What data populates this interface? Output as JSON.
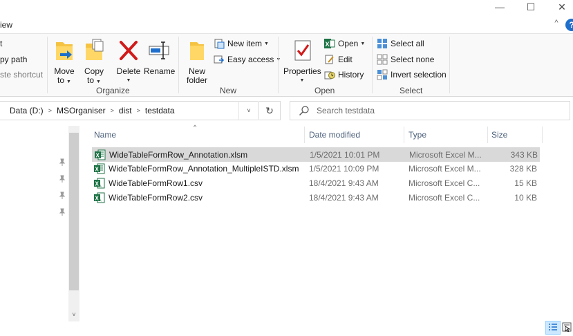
{
  "window": {
    "minimize_glyph": "—",
    "maximize_glyph": "☐",
    "close_glyph": "✕"
  },
  "ribbon_tabs": {
    "view_label_partial": "iew",
    "collapse_glyph": "^",
    "help_glyph": "?"
  },
  "clipboard": {
    "cut_partial": "t",
    "copy_path_partial": "py path",
    "paste_shortcut_partial": "ste shortcut"
  },
  "organize": {
    "label": "Organize",
    "move_to_line1": "Move",
    "move_to_line2": "to",
    "copy_to_line1": "Copy",
    "copy_to_line2": "to",
    "delete_label": "Delete",
    "rename_label": "Rename"
  },
  "new_group": {
    "label": "New",
    "new_folder_line1": "New",
    "new_folder_line2": "folder",
    "new_item_label": "New item",
    "easy_access_label": "Easy access"
  },
  "open_group": {
    "label": "Open",
    "properties_label": "Properties",
    "open_label": "Open",
    "edit_label": "Edit",
    "history_label": "History"
  },
  "select_group": {
    "label": "Select",
    "select_all_label": "Select all",
    "select_none_label": "Select none",
    "invert_selection_label": "Invert selection"
  },
  "address": {
    "segments": [
      "Data (D:)",
      "MSOrganiser",
      "dist",
      "testdata"
    ],
    "dropdown_glyph": "˅",
    "refresh_glyph": "↻"
  },
  "search": {
    "placeholder": "Search testdata"
  },
  "columns": {
    "name": "Name",
    "date_modified": "Date modified",
    "type": "Type",
    "size": "Size",
    "sort_glyph": "^"
  },
  "files": [
    {
      "name": "WideTableFormRow_Annotation.xlsm",
      "date": "1/5/2021 10:01 PM",
      "type": "Microsoft Excel M...",
      "size": "343 KB",
      "selected": true
    },
    {
      "name": "WideTableFormRow_Annotation_MultipleISTD.xlsm",
      "date": "1/5/2021 10:09 PM",
      "type": "Microsoft Excel M...",
      "size": "328 KB",
      "selected": false
    },
    {
      "name": "WideTableFormRow1.csv",
      "date": "18/4/2021 9:43 AM",
      "type": "Microsoft Excel C...",
      "size": "15 KB",
      "selected": false
    },
    {
      "name": "WideTableFormRow2.csv",
      "date": "18/4/2021 9:43 AM",
      "type": "Microsoft Excel C...",
      "size": "10 KB",
      "selected": false
    }
  ],
  "colors": {
    "accent_blue": "#1e6fcc",
    "delete_red": "#d11a1a",
    "folder_yellow": "#f5c342",
    "excel_green": "#1d7245",
    "selection_gray": "#d9d9d9",
    "header_text": "#4c607a"
  },
  "nav": {
    "scroll_down_glyph": "˅",
    "pin_glyph": "📌"
  }
}
